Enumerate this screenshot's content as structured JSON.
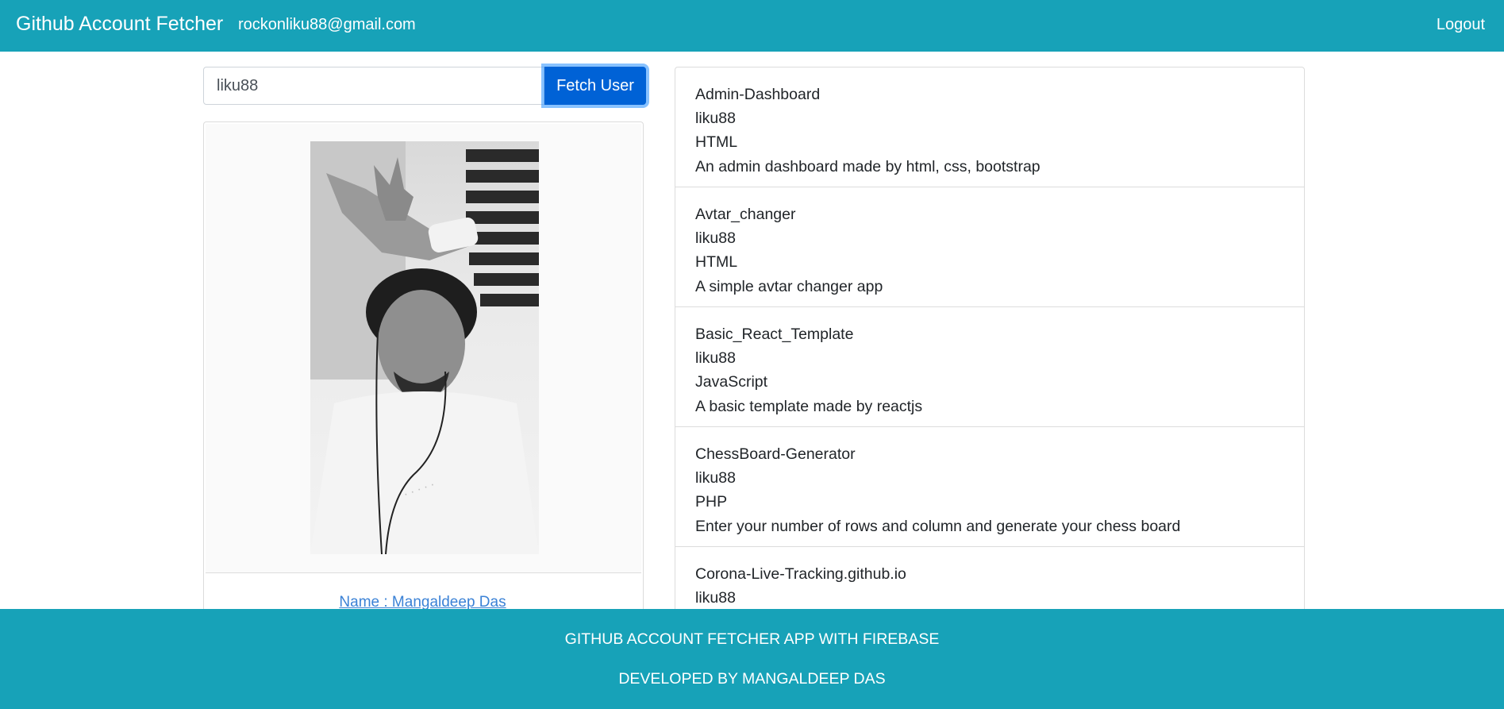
{
  "navbar": {
    "brand": "Github Account Fetcher",
    "user_email": "rockonliku88@gmail.com",
    "logout_label": "Logout"
  },
  "search": {
    "value": "liku88",
    "button_label": "Fetch User"
  },
  "profile": {
    "name_label": "Name : Mangaldeep Das"
  },
  "repos": [
    {
      "name": "Admin-Dashboard",
      "owner": "liku88",
      "language": "HTML",
      "description": "An admin dashboard made by html, css, bootstrap"
    },
    {
      "name": "Avtar_changer",
      "owner": "liku88",
      "language": "HTML",
      "description": "A simple avtar changer app"
    },
    {
      "name": "Basic_React_Template",
      "owner": "liku88",
      "language": "JavaScript",
      "description": "A basic template made by reactjs"
    },
    {
      "name": "ChessBoard-Generator",
      "owner": "liku88",
      "language": "PHP",
      "description": "Enter your number of rows and column and generate your chess board"
    },
    {
      "name": "Corona-Live-Tracking.github.io",
      "owner": "liku88",
      "language": "",
      "description": ""
    }
  ],
  "footer": {
    "line1": "GITHUB ACCOUNT FETCHER APP WITH FIREBASE",
    "line2": "DEVELOPED BY MANGALDEEP DAS"
  },
  "colors": {
    "navbar_bg": "#17a2b8",
    "button_bg": "#0062d6",
    "link": "#3b82d6"
  }
}
